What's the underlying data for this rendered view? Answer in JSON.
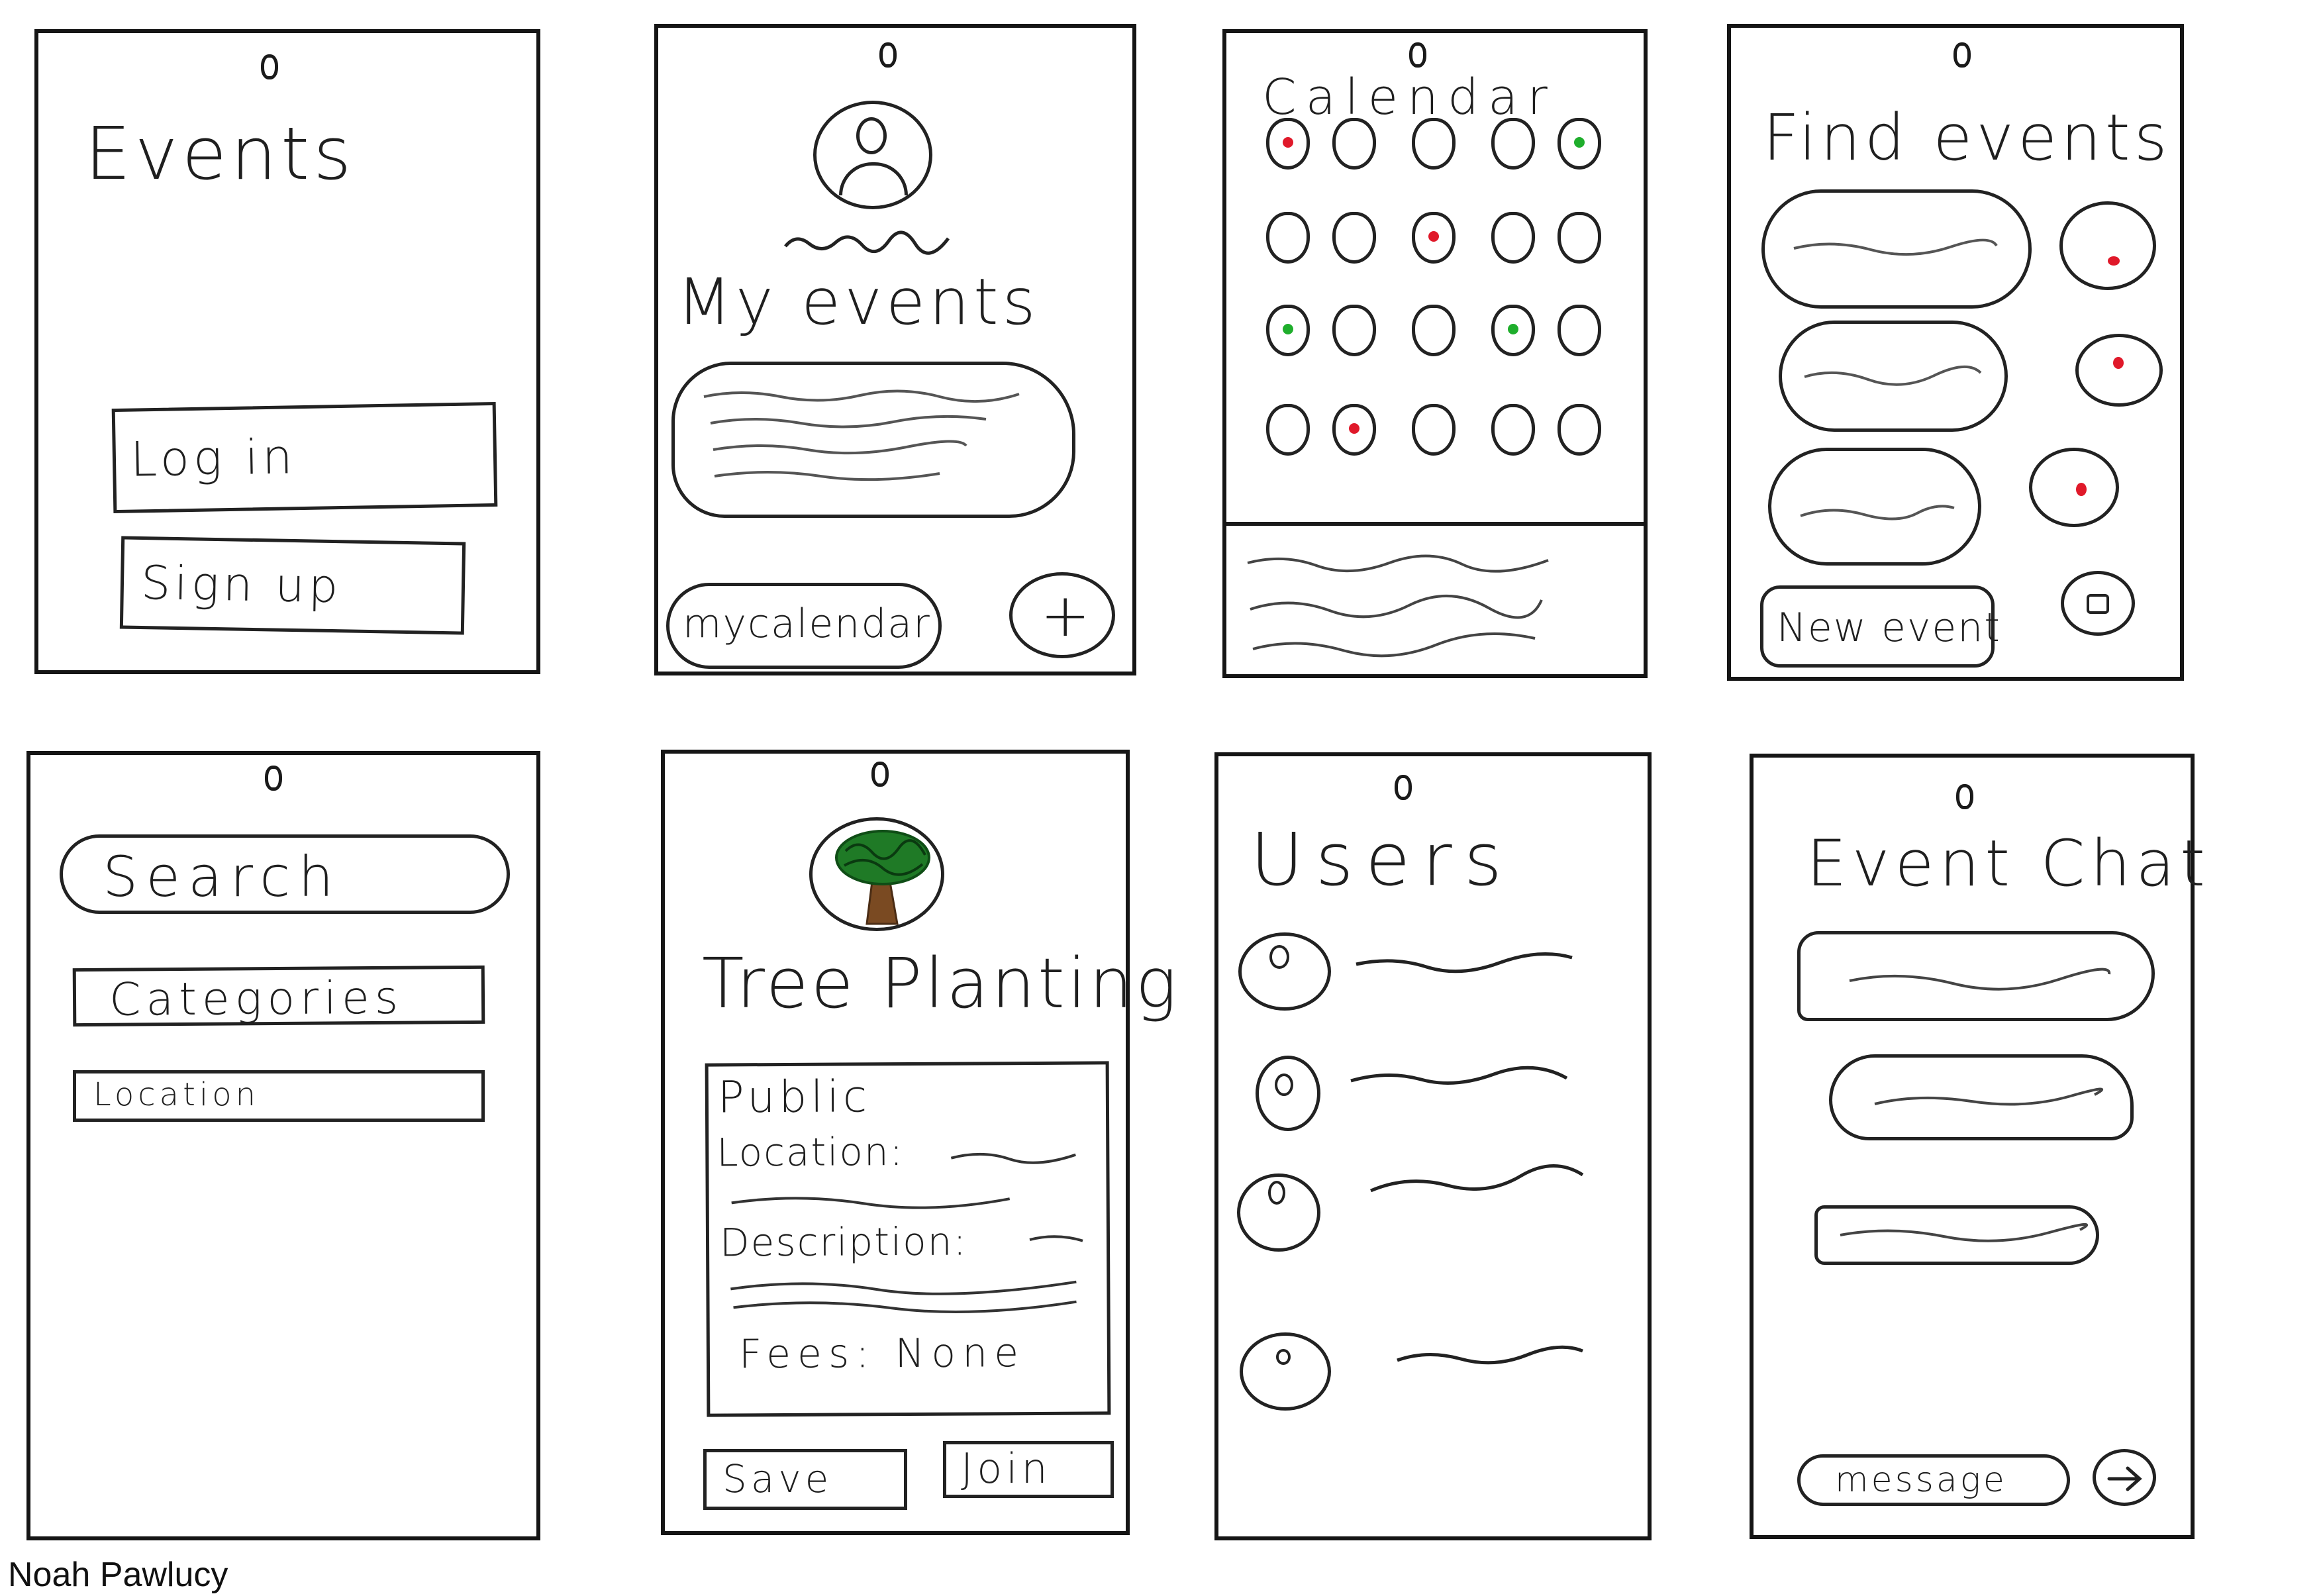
{
  "author": "Noah Pawlucy",
  "screens": {
    "events": {
      "title": "Events",
      "login_label": "Log in",
      "signup_label": "Sign up"
    },
    "my_events": {
      "title": "My events",
      "calendar_button": "mycalendar",
      "add_button": "+"
    },
    "calendar": {
      "title": "Calendar",
      "day_markers": [
        {
          "row": 0,
          "col": 0,
          "color": "#e0192a"
        },
        {
          "row": 0,
          "col": 4,
          "color": "#1fae2c"
        },
        {
          "row": 1,
          "col": 2,
          "color": "#e0192a"
        },
        {
          "row": 2,
          "col": 0,
          "color": "#1fae2c"
        },
        {
          "row": 2,
          "col": 3,
          "color": "#1fae2c"
        },
        {
          "row": 3,
          "col": 1,
          "color": "#e0192a"
        }
      ]
    },
    "find_events": {
      "title": "Find events",
      "new_event_button": "New event",
      "map_pin_color": "#e0192a"
    },
    "search": {
      "search_label": "Search",
      "categories_label": "Categories",
      "location_label": "Location"
    },
    "event_detail": {
      "title": "Tree Planting",
      "public_label": "Public",
      "location_label": "Location:",
      "description_label": "Description:",
      "fees_label": "Fees: None",
      "save_button": "Save",
      "join_button": "Join",
      "tree_foliage_color": "#1f7a26",
      "tree_trunk_color": "#7a4a22"
    },
    "users": {
      "title": "Users"
    },
    "event_chat": {
      "title": "Event Chat",
      "message_placeholder": "message",
      "send_icon": "arrow-right-icon"
    }
  }
}
